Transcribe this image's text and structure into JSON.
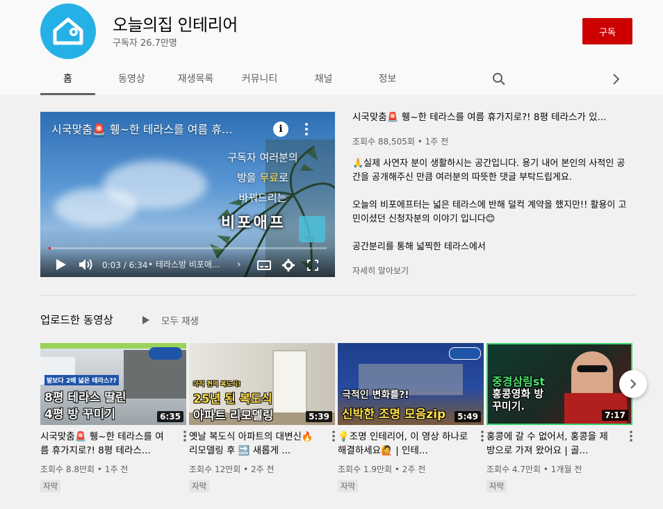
{
  "channel": {
    "name": "오늘의집 인테리어",
    "subscribers": "구독자 26.7만명",
    "subscribe_label": "구독",
    "avatar_icon": "house-icon",
    "brand_color": "#26b1e6",
    "subscribe_color": "#cc0000"
  },
  "tabs": [
    {
      "label": "홈",
      "active": true
    },
    {
      "label": "동영상"
    },
    {
      "label": "재생목록"
    },
    {
      "label": "커뮤니티"
    },
    {
      "label": "채널"
    },
    {
      "label": "정보"
    }
  ],
  "featured": {
    "overlay_title": "시국맞춤🚨 휑~한 테라스를 여름 휴...",
    "title": "시국맞춤🚨 휑~한 테라스를 여름 휴가지로?! 8평 테라스가 있...",
    "meta": "조회수 88,505회 • 1주 전",
    "desc_p1": "🙏실제 사연자 분이 생활하시는 공간입니다. 용기 내어 본인의 사적인 공간을 공개해주신 만큼 여러분의 따뜻한 댓글 부탁드립게요.",
    "desc_p2": "오늘의 비포에프터는 넓은 테라스에 반해 덜컥 계약을 했지만!! 활용이 고민이셨던 신청자분의 이야기 입니다😊",
    "desc_p3": "공간분리를 통해 넓찍한 테라스에서",
    "more_label": "자세히 알아보기",
    "promo_line1": "구독자 여러분의",
    "promo_line2a": "방을 ",
    "promo_line2b": "무료",
    "promo_line2c": "로",
    "promo_line3": "바꿔드리는",
    "promo_brand": "비포애프",
    "player": {
      "time": "0:03 / 6:34",
      "chapter": "• 테라스방 비포애...",
      "progress": 0.008
    }
  },
  "shelf": {
    "title": "업로드한 동영상",
    "play_all": "모두 재생"
  },
  "videos": [
    {
      "thumb_small": "발보다 2배 넓은 테라스??",
      "thumb_line1": "8평 테라스 딸린",
      "thumb_line2": "4평 방 꾸미기",
      "duration": "6:35",
      "title": "시국맞춤🚨 휑~한 테라스를 여름 휴가지로?! 8평 테라스...",
      "meta": "조회수 8.8만회 • 1주 전",
      "badge": "자막"
    },
    {
      "thumb_small": "아직 현역 복도식!",
      "thumb_line1": "25년 된 복도식",
      "thumb_line2": "아파트 리모델링",
      "duration": "5:39",
      "title": "옛날 복도식 아파트의 대변신🔥 리모델링 후 🔜 새롭게 ...",
      "meta": "조회수 12만회 • 2주 전",
      "badge": "자막"
    },
    {
      "thumb_small": "",
      "thumb_line1": "극적인 변화를?!",
      "thumb_line2": "신박한 조명 모음zip",
      "duration": "5:49",
      "title": "💡조명 인테리어, 이 영상 하나로 해결하세요🙋 | 인테...",
      "meta": "조회수 1.9만회 • 2주 전",
      "badge": "자막"
    },
    {
      "thumb_small": "",
      "thumb_line1": "중경삼림st",
      "thumb_line2": "홍콩영화 방꾸미기.",
      "duration": "7:17",
      "title": "홍콩에 갈 수 없어서, 홍콩을 제 방으로 가져 왔어요 | 골...",
      "meta": "조회수 4.7만회 • 1개월 전",
      "badge": "자막"
    }
  ]
}
